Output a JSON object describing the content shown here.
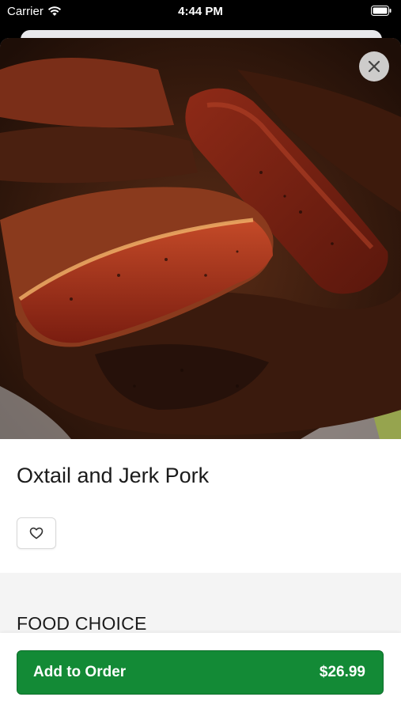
{
  "status_bar": {
    "carrier": "Carrier",
    "time": "4:44 PM"
  },
  "item": {
    "title": "Oxtail and Jerk Pork"
  },
  "section": {
    "title": "FOOD CHOICE"
  },
  "footer": {
    "add_label": "Add to Order",
    "price": "$26.99"
  },
  "colors": {
    "accent": "#138a36"
  }
}
